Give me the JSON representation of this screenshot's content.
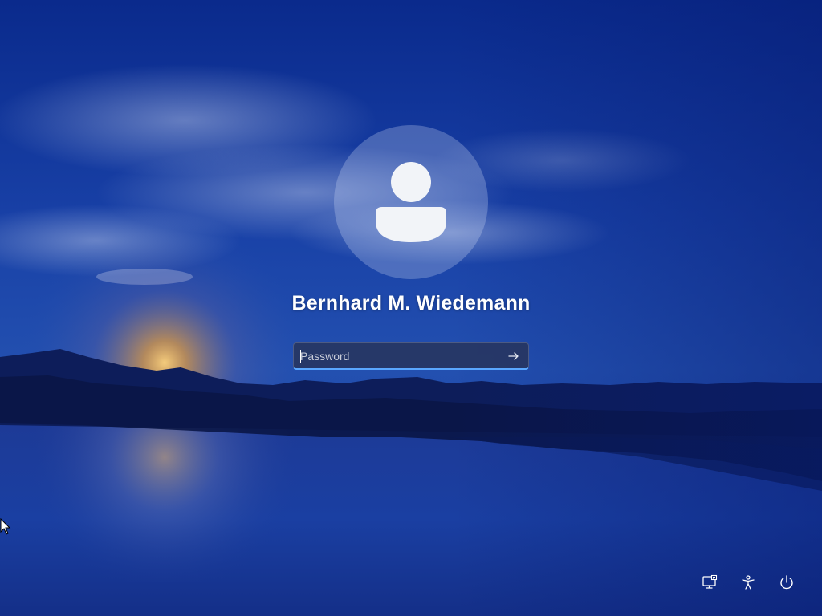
{
  "lock_screen": {
    "user": {
      "name": "Bernhard M. Wiedemann",
      "avatar_icon": "user-silhouette-icon"
    },
    "password": {
      "placeholder": "Password",
      "value": "",
      "submit_icon": "arrow-right-icon"
    },
    "bottom_bar": [
      {
        "id": "network",
        "icon": "network-icon"
      },
      {
        "id": "accessibility",
        "icon": "accessibility-icon"
      },
      {
        "id": "power",
        "icon": "power-icon"
      }
    ]
  },
  "colors": {
    "accent": "#5aa7ff",
    "text": "#ffffff",
    "wallpaper_sky": "#0b2a8a",
    "sunset_glow": "#f0a23a"
  }
}
